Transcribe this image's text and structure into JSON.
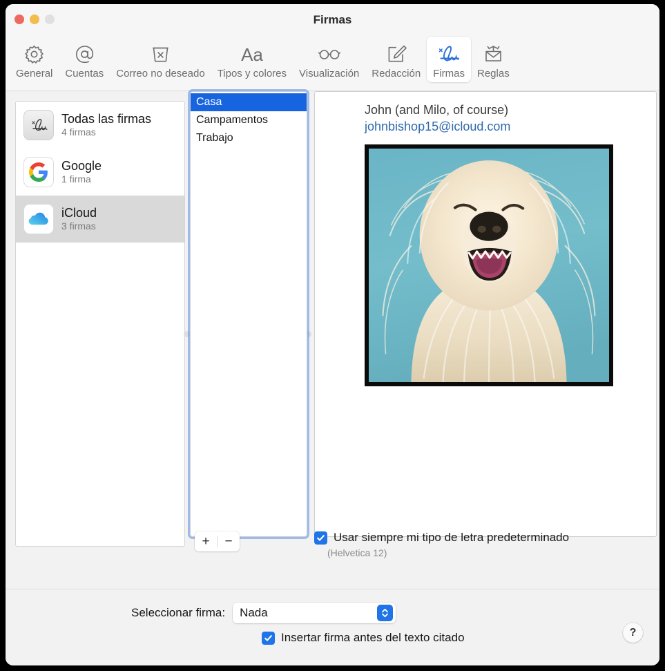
{
  "window": {
    "title": "Firmas",
    "traffic_lights": [
      "close",
      "minimize",
      "zoom"
    ]
  },
  "toolbar": {
    "items": [
      {
        "label": "General",
        "icon": "gear-icon",
        "selected": false
      },
      {
        "label": "Cuentas",
        "icon": "at-sign-icon",
        "selected": false
      },
      {
        "label": "Correo no deseado",
        "icon": "junk-bin-icon",
        "selected": false
      },
      {
        "label": "Tipos y colores",
        "icon": "fonts-colors-icon",
        "selected": false
      },
      {
        "label": "Visualización",
        "icon": "eyeglasses-icon",
        "selected": false
      },
      {
        "label": "Redacción",
        "icon": "compose-pencil-icon",
        "selected": false
      },
      {
        "label": "Firmas",
        "icon": "signature-icon",
        "selected": true
      },
      {
        "label": "Reglas",
        "icon": "rules-envelope-icon",
        "selected": false
      }
    ]
  },
  "accounts": {
    "items": [
      {
        "name": "Todas las firmas",
        "sub": "4 firmas",
        "icon": "signature-icon",
        "selected": false
      },
      {
        "name": "Google",
        "sub": "1 firma",
        "icon": "google-g-icon",
        "selected": false
      },
      {
        "name": "iCloud",
        "sub": "3 firmas",
        "icon": "icloud-icon",
        "selected": true
      }
    ]
  },
  "signature_list": {
    "items": [
      {
        "label": "Casa",
        "selected": true
      },
      {
        "label": "Campamentos",
        "selected": false
      },
      {
        "label": "Trabajo",
        "selected": false
      }
    ],
    "add_label": "+",
    "remove_label": "−"
  },
  "preview": {
    "name": "John (and Milo, of course)",
    "email": "johnbishop15@icloud.com",
    "image_alt": "afghan-hound-photo"
  },
  "options": {
    "default_font": {
      "label": "Usar siempre mi tipo de letra predeterminado",
      "sub": "(Helvetica 12)",
      "checked": true
    },
    "before_quoted": {
      "label": "Insertar firma antes del texto citado",
      "checked": true
    }
  },
  "footer": {
    "select_label": "Seleccionar firma:",
    "select_value": "Nada",
    "help_label": "?"
  },
  "colors": {
    "accent": "#1f74e8",
    "selection": "#1664e0",
    "link": "#2e6ab0",
    "signature_blue": "#2b6fd8"
  }
}
